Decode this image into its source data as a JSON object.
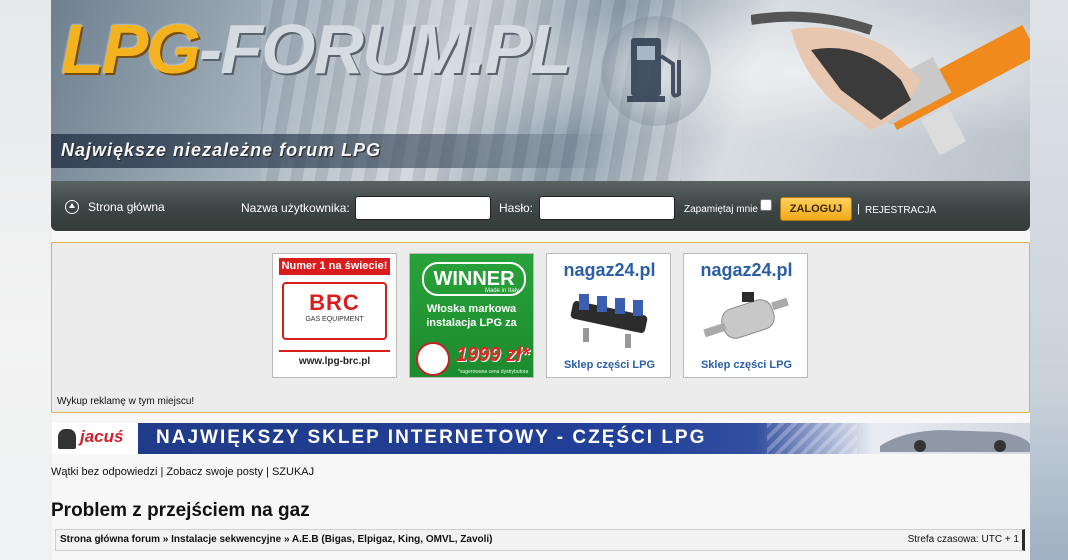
{
  "header": {
    "logo_primary": "LPG",
    "logo_secondary": "-FORUM.PL",
    "tagline": "Największe niezależne forum LPG"
  },
  "navbar": {
    "home_label": "Strona główna",
    "username_label": "Nazwa użytkownika:",
    "username_value": "",
    "password_label": "Hasło:",
    "password_value": "",
    "remember_label": "Zapamiętaj mnie",
    "remember_checked": false,
    "login_button": "ZALOGUJ",
    "separator": "|",
    "register_link": "REJESTRACJA"
  },
  "ads": {
    "brc": {
      "top": "Numer 1 na świecie!",
      "brand": "BRC",
      "sub": "GAS EQUIPMENT",
      "url": "www.lpg-brc.pl"
    },
    "winner": {
      "brand": "WINNER",
      "made": "Made in Italy",
      "text": "Włoska markowa instalacja LPG za",
      "price": "1999 zł*",
      "note": "*sugerowana cena dystrybutora"
    },
    "nagaz1": {
      "brand": "nagaz24.pl",
      "caption": "Sklep części LPG"
    },
    "nagaz2": {
      "brand": "nagaz24.pl",
      "caption": "Sklep części LPG"
    },
    "buy_space": "Wykup reklamę w tym miejscu!"
  },
  "jacus_banner": {
    "brand": "jacuś",
    "text": "NAJWIĘKSZY SKLEP INTERNETOWY - CZĘŚCI LPG"
  },
  "links": {
    "unanswered": "Wątki bez odpowiedzi",
    "sep1": "|",
    "your_posts": "Zobacz swoje posty",
    "sep2": "|",
    "search": "SZUKAJ"
  },
  "page_title": "Problem z przejściem na gaz",
  "breadcrumb": {
    "path": "Strona główna forum » Instalacje sekwencyjne » A.E.B (Bigas, Elpigaz, King, OMVL, Zavoli)",
    "timezone": "Strefa czasowa: UTC + 1"
  }
}
